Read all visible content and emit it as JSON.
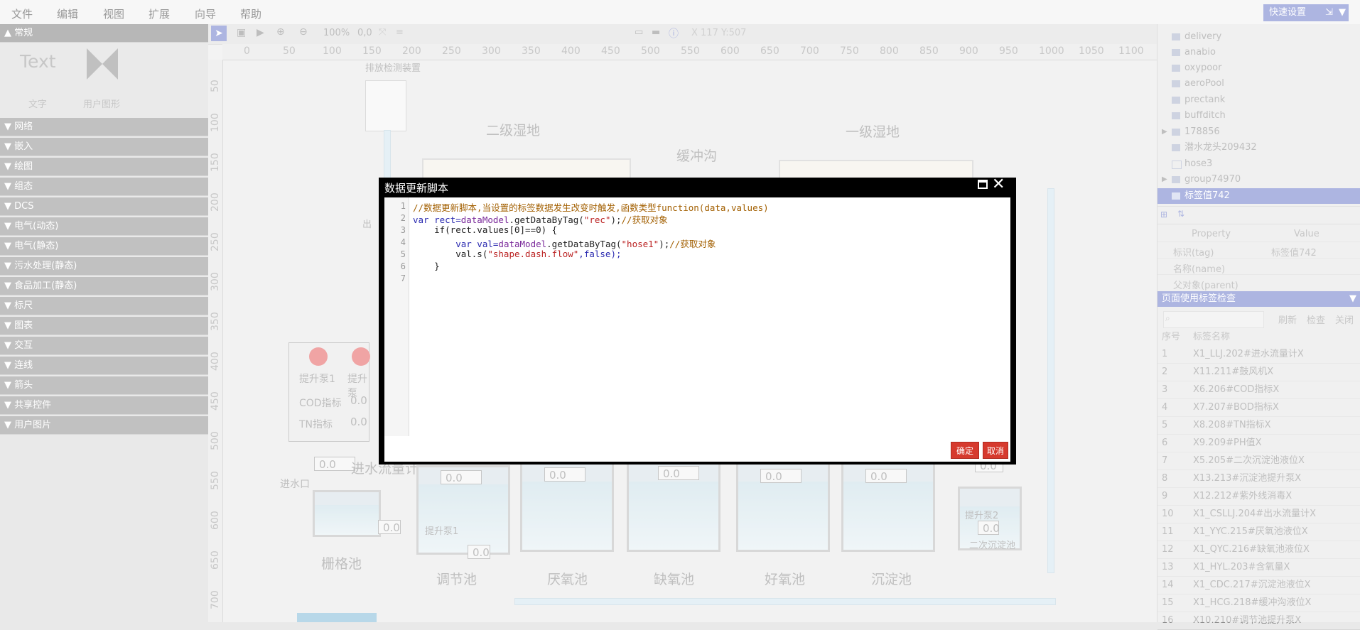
{
  "menubar": {
    "items": [
      "文件",
      "编辑",
      "视图",
      "扩展",
      "向导",
      "帮助"
    ],
    "quick_settings": "快速设置"
  },
  "toolbar": {
    "zoom": "100%",
    "offset": "0,0",
    "coords": "X 117 Y:507"
  },
  "leftpanel": {
    "common_header": "▲ 常规",
    "text_tool_glyph": "Text",
    "text_tool_label": "文字",
    "user_shape_label": "用户图形",
    "categories": [
      "▼ 网络",
      "▼ 嵌入",
      "▼ 绘图",
      "▼ 组态",
      "▼ DCS",
      "▼ 电气(动态)",
      "▼ 电气(静态)",
      "▼ 污水处理(静态)",
      "▼ 食品加工(静态)",
      "▼ 标尺",
      "▼ 图表",
      "▼ 交互",
      "▼ 连线",
      "▼ 箭头",
      "▼ 共享控件",
      "▼ 用户图片"
    ]
  },
  "ruler": {
    "top": [
      "0",
      "50",
      "100",
      "150",
      "200",
      "250",
      "300",
      "350",
      "400",
      "450",
      "500",
      "550",
      "600",
      "650",
      "700",
      "750",
      "800",
      "850",
      "900",
      "950",
      "1000",
      "1050",
      "1100"
    ],
    "left": [
      "50",
      "100",
      "150",
      "200",
      "250",
      "300",
      "350",
      "400",
      "450",
      "500",
      "550",
      "600",
      "650",
      "700"
    ]
  },
  "canvas": {
    "labels": {
      "emission": "排放检测装置",
      "wetland2": "二级湿地",
      "wetland1": "一级湿地",
      "buffer": "缓冲沟",
      "grid": "栅格池",
      "adjust": "调节池",
      "anaerobic": "厌氧池",
      "anoxic": "缺氧池",
      "aerobic": "好氧池",
      "settle": "沉淀池",
      "lift_pump1": "提升泵1",
      "lift_pump_cut": "提升泵",
      "cod": "COD指标",
      "tn": "TN指标",
      "inflow_meter": "进水流量计",
      "inlet": "进水口",
      "lift_pump1b": "提升泵1",
      "lift_pump2": "提升泵2",
      "secondary_settle": "二次沉淀池",
      "out_cut": "出"
    },
    "value": "0.0"
  },
  "rightpanel": {
    "tree": [
      "delivery",
      "anabio",
      "oxypoor",
      "aeroPool",
      "prectank",
      "buffditch",
      "178856",
      "潜水龙头209432",
      "hose3",
      "group74970",
      "标签值742"
    ],
    "prop_header": [
      "Property",
      "Value"
    ],
    "props": [
      {
        "k": "标识(tag)",
        "v": "标签值742"
      },
      {
        "k": "名称(name)",
        "v": ""
      },
      {
        "k": "父对象(parent)",
        "v": ""
      }
    ],
    "tagcheck_title": "页面使用标签检查",
    "tagcheck_buttons": [
      "刷新",
      "检查",
      "关闭"
    ],
    "tag_header": [
      "序号",
      "标签名称"
    ],
    "tags": [
      [
        "1",
        "X1_LLJ.202#进水流量计X"
      ],
      [
        "2",
        "X11.211#鼓风机X"
      ],
      [
        "3",
        "X6.206#COD指标X"
      ],
      [
        "4",
        "X7.207#BOD指标X"
      ],
      [
        "5",
        "X8.208#TN指标X"
      ],
      [
        "6",
        "X9.209#PH值X"
      ],
      [
        "7",
        "X5.205#二次沉淀池液位X"
      ],
      [
        "8",
        "X13.213#沉淀池提升泵X"
      ],
      [
        "9",
        "X12.212#紫外线消毒X"
      ],
      [
        "10",
        "X1_CSLLJ.204#出水流量计X"
      ],
      [
        "11",
        "X1_YYC.215#厌氧池液位X"
      ],
      [
        "12",
        "X1_QYC.216#缺氧池液位X"
      ],
      [
        "13",
        "X1_HYL.203#含氧量X"
      ],
      [
        "14",
        "X1_CDC.217#沉淀池液位X"
      ],
      [
        "15",
        "X1_HCG.218#缓冲沟液位X"
      ],
      [
        "16",
        "X10.210#调节池提升泵X"
      ]
    ]
  },
  "modal": {
    "title": "数据更新脚本",
    "line_numbers": [
      "1",
      "2",
      "3",
      "4",
      "5",
      "6",
      "7"
    ],
    "ok": "确定",
    "cancel": "取消",
    "code": {
      "l1": "//数据更新脚本,当设置的标签数据发生改变时触发,函数类型function(data,values)",
      "l2a": "var rect=",
      "l2b": "dataModel",
      "l2c": ".getDataByTag(",
      "l2d": "\"rec\"",
      "l2e": ");",
      "l2f": "//获取对象",
      "l3": "    if(rect.values[0]==0) {",
      "l4a": "        var val=",
      "l4b": "dataModel",
      "l4c": ".getDataByTag(",
      "l4d": "\"hose1\"",
      "l4e": ");",
      "l4f": "//获取对象",
      "l5a": "        val.s(",
      "l5b": "\"shape.dash.flow\"",
      "l5c": ",false);",
      "l6": "    }"
    }
  }
}
